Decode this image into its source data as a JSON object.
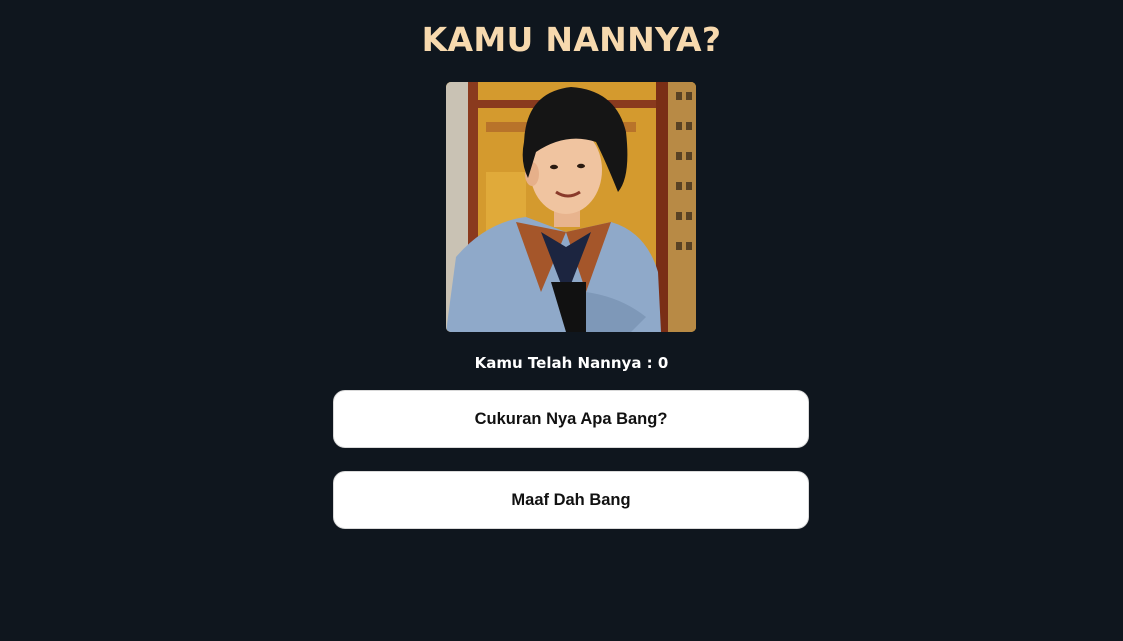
{
  "header": {
    "title": "KAMU NANNYA?"
  },
  "image": {
    "alt": "",
    "subject": "portrait-photo"
  },
  "counter": {
    "text": "Kamu Telah Nannya : 0"
  },
  "buttons": [
    {
      "label": "Cukuran Nya Apa Bang?"
    },
    {
      "label": "Maaf Dah Bang"
    }
  ],
  "colors": {
    "background": "#0f161e",
    "title": "#f7d9ae",
    "button_bg": "#ffffff",
    "button_text": "#111111"
  }
}
